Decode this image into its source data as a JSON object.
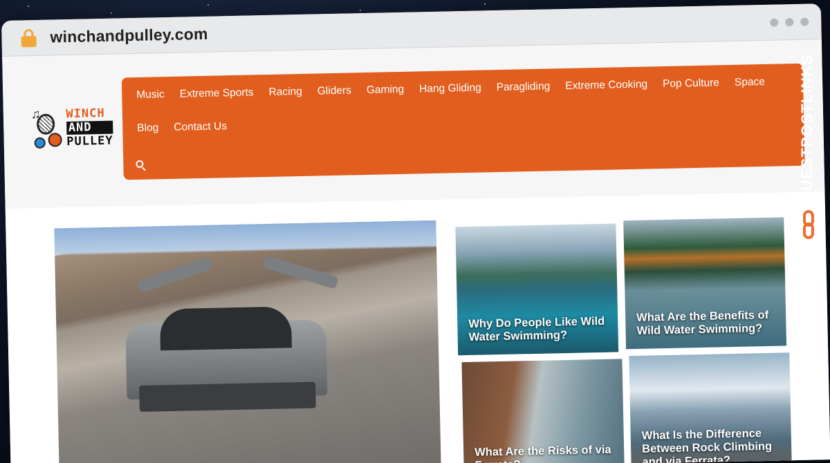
{
  "browser": {
    "url": "winchandpulley.com"
  },
  "logo": {
    "line1": "WINCH",
    "line2": "AND",
    "line3": "PULLEY"
  },
  "nav": {
    "items": [
      "Music",
      "Extreme Sports",
      "Racing",
      "Gliders",
      "Gaming",
      "Hang Gliding",
      "Paragliding",
      "Extreme Cooking",
      "Pop Culture",
      "Space",
      "Blog",
      "Contact Us"
    ]
  },
  "articles": [
    {
      "title": "Why Do People Like Wild Water Swimming?"
    },
    {
      "title": "What Are the Benefits of Wild Water Swimming?"
    },
    {
      "title": "What Are the Risks of via Ferrata?"
    },
    {
      "title": "What Is the Difference Between Rock Climbing and via Ferrata?"
    }
  ],
  "side_brand": {
    "text": "GUESTPOSTLINKS"
  },
  "colors": {
    "nav_bg": "#e15e1f",
    "lock": "#f2a73b",
    "brand_orange": "#ec6c31"
  }
}
